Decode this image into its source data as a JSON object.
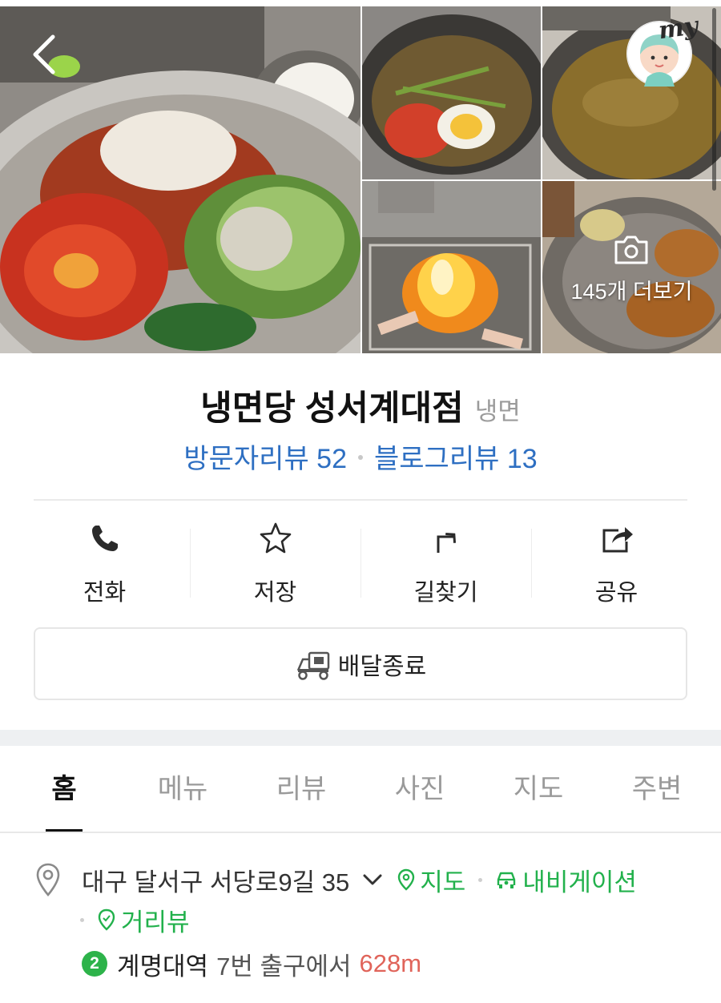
{
  "photos": {
    "more_label": "145개 더보기",
    "my_label": "my"
  },
  "icons": {
    "back": "chevron-left-icon",
    "camera": "camera-icon",
    "phone": "phone-icon",
    "star": "star-icon",
    "directions": "directions-icon",
    "share": "share-icon",
    "delivery": "delivery-scooter-icon",
    "pin": "map-pin-icon",
    "car": "car-icon"
  },
  "shop": {
    "name": "냉면당 성서계대점",
    "category": "냉면"
  },
  "reviews": {
    "visitor": "방문자리뷰 52",
    "blog": "블로그리뷰 13"
  },
  "actions": [
    {
      "label": "전화"
    },
    {
      "label": "저장"
    },
    {
      "label": "길찾기"
    },
    {
      "label": "공유"
    }
  ],
  "delivery": {
    "label": "배달종료"
  },
  "tabs": [
    {
      "label": "홈",
      "active": true
    },
    {
      "label": "메뉴",
      "active": false
    },
    {
      "label": "리뷰",
      "active": false
    },
    {
      "label": "사진",
      "active": false
    },
    {
      "label": "지도",
      "active": false
    },
    {
      "label": "주변",
      "active": false
    }
  ],
  "address": {
    "text": "대구 달서구 서당로9길 35",
    "map_link": "지도",
    "navigation_link": "내비게이션",
    "streetview_link": "거리뷰"
  },
  "subway": {
    "line": "2",
    "station": "계명대역",
    "exit": "7번 출구에서",
    "distance": "628m"
  },
  "colors": {
    "review_blue": "#2e6fc2",
    "link_green": "#22b14c",
    "distance_red": "#e0645a",
    "subway_line2": "#2db34a"
  }
}
